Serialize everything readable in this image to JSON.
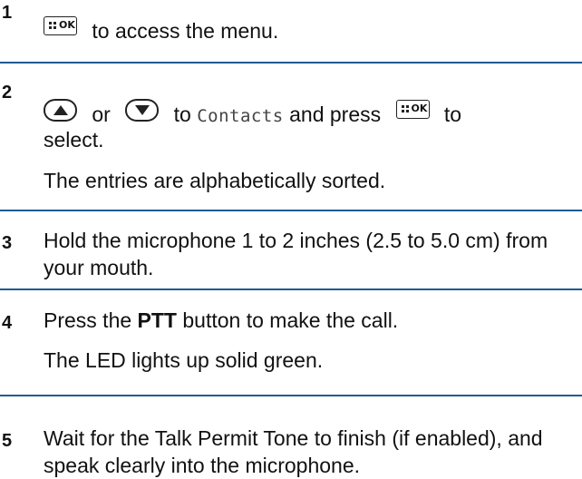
{
  "steps": [
    {
      "number": "1",
      "text_after_ok": "to access the menu."
    },
    {
      "number": "2",
      "word_or": "or",
      "word_to": "to",
      "menu_item": "Contacts",
      "and_press": "and press",
      "tail_to": "to",
      "line2": "select.",
      "note": "The entries are alphabetically sorted."
    },
    {
      "number": "3",
      "text": "Hold the microphone 1 to 2 inches (2.5 to 5.0 cm) from your mouth."
    },
    {
      "number": "4",
      "prefix": "Press the",
      "button_name": "PTT",
      "suffix": "button to make the call.",
      "note": "The LED lights up solid green."
    },
    {
      "number": "5",
      "text": "Wait for the Talk Permit Tone to finish (if enabled), and speak clearly into the microphone."
    }
  ],
  "keys": {
    "ok_key_label": "OK",
    "ok_key_icon": "menu-ok-key-icon",
    "up_key_icon": "up-arrow-key-icon",
    "down_key_icon": "down-arrow-key-icon"
  },
  "colors": {
    "divider": "#1f5b93",
    "text": "#111111"
  }
}
